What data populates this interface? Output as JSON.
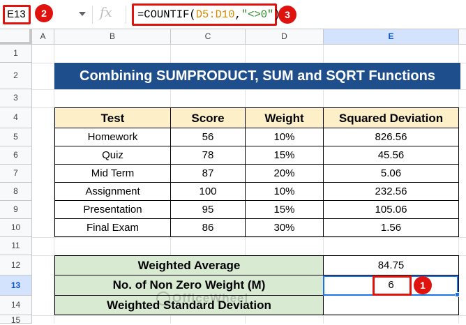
{
  "formula_bar": {
    "name_box": "E13",
    "fx_label": "fx",
    "formula": {
      "prefix": "=COUNTIF(",
      "range": "D5:D10",
      "comma": ",",
      "criteria": "\"<>0\"",
      "suffix": ")"
    }
  },
  "badges": [
    "1",
    "2",
    "3"
  ],
  "columns": [
    "A",
    "B",
    "C",
    "D",
    "E"
  ],
  "selected_column": "E",
  "rows": [
    "1",
    "2",
    "3",
    "4",
    "5",
    "6",
    "7",
    "8",
    "9",
    "10",
    "11",
    "12",
    "13",
    "14",
    "15"
  ],
  "selected_row": "13",
  "title": "Combining SUMPRODUCT, SUM and SQRT Functions",
  "table": {
    "headers": [
      "Test",
      "Score",
      "Weight",
      "Squared Deviation"
    ],
    "rows": [
      [
        "Homework",
        "56",
        "10%",
        "826.56"
      ],
      [
        "Quiz",
        "78",
        "15%",
        "45.56"
      ],
      [
        "Mid Term",
        "87",
        "20%",
        "5.06"
      ],
      [
        "Assignment",
        "100",
        "10%",
        "232.56"
      ],
      [
        "Presentation",
        "95",
        "15%",
        "105.06"
      ],
      [
        "Final Exam",
        "86",
        "30%",
        "1.56"
      ]
    ]
  },
  "summary": [
    {
      "label": "Weighted Average",
      "value": "84.75"
    },
    {
      "label": "No. of Non Zero Weight (M)",
      "value": "6"
    },
    {
      "label": "Weighted Standard Deviation",
      "value": ""
    }
  ],
  "watermark": "OfficeWheel",
  "colors": {
    "title_bg": "#1f4e8c",
    "header_bg": "#fdf0c8",
    "summary_bg": "#d9ead3",
    "annotation_red": "#e0120e",
    "selection_blue": "#1a73e8"
  }
}
